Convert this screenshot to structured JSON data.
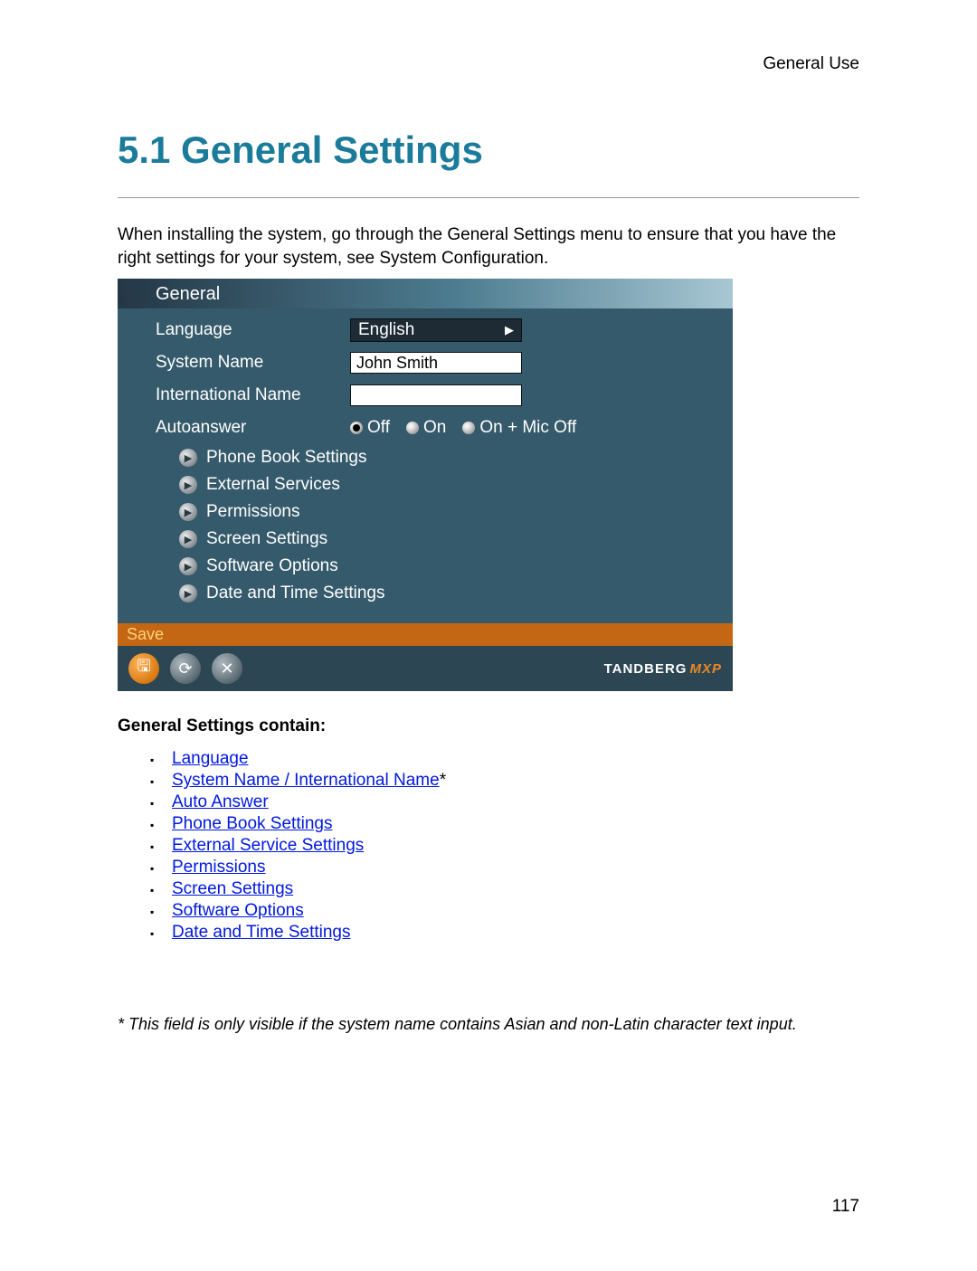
{
  "header_right": "General Use",
  "title": "5.1 General Settings",
  "intro": "When installing the system, go through the General Settings menu to ensure that you have the right settings for your system, see System Configuration.",
  "screenshot": {
    "header": "General",
    "rows": {
      "language": {
        "label": "Language",
        "value": "English"
      },
      "system_name": {
        "label": "System Name",
        "value": "John Smith"
      },
      "intl_name": {
        "label": "International Name",
        "value": ""
      },
      "autoanswer": {
        "label": "Autoanswer",
        "options": [
          "Off",
          "On",
          "On + Mic Off"
        ],
        "selected": 0
      }
    },
    "submenus": [
      "Phone Book Settings",
      "External Services",
      "Permissions",
      "Screen Settings",
      "Software Options",
      "Date and Time Settings"
    ],
    "save_label": "Save",
    "brand": "TANDBERG",
    "brand_suffix": "MXP"
  },
  "list_heading": "General Settings contain:",
  "links": [
    "Language",
    "System Name / International Name",
    "Auto Answer",
    "Phone Book Settings",
    "External Service Settings",
    "Permissions",
    "Screen Settings",
    "Software Options",
    "Date and Time Settings"
  ],
  "link_asterisk_index": 1,
  "footnote": "* This field is only visible if the system name contains Asian and non-Latin character text input.",
  "page_number": "117"
}
